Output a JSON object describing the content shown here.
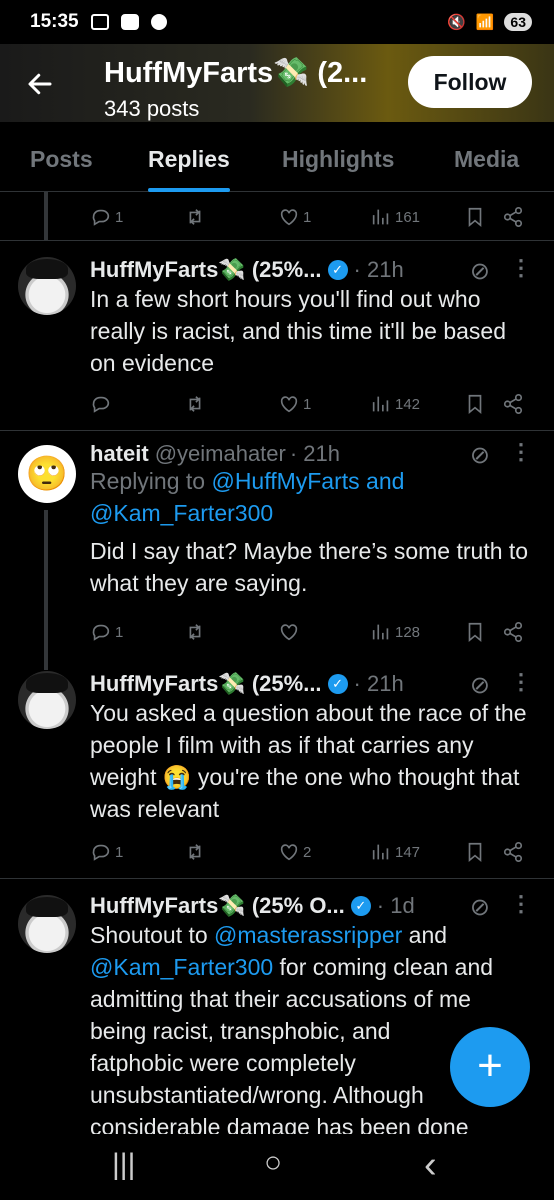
{
  "status_bar": {
    "time": "15:35",
    "battery": "63"
  },
  "header": {
    "title": "HuffMyFarts💸 (2...",
    "posts_count": "343 posts",
    "follow_label": "Follow"
  },
  "tabs": [
    {
      "label": "Posts",
      "active": false
    },
    {
      "label": "Replies",
      "active": true
    },
    {
      "label": "Highlights",
      "active": false
    },
    {
      "label": "Media",
      "active": false
    }
  ],
  "top_actions": {
    "replies": "1",
    "reposts": "",
    "likes": "1",
    "views": "161"
  },
  "tweets": [
    {
      "name": "HuffMyFarts💸 (25%...",
      "handle": "",
      "time": "· 21h",
      "verified": true,
      "reply_to_prefix": "",
      "body": "In a few short hours you'll find out who really is racist, and this time it'll be based on evidence",
      "stats": {
        "replies": "",
        "reposts": "",
        "likes": "1",
        "views": "142"
      }
    },
    {
      "name": "hateit",
      "handle": "@yeimahater",
      "time": "· 21h",
      "verified": false,
      "reply_to_prefix": "Replying to",
      "reply_to_1": "@HuffMyFarts and",
      "reply_to_2": "@Kam_Farter300",
      "body": "Did I say that? Maybe there’s some truth to what they are saying.",
      "stats": {
        "replies": "1",
        "reposts": "",
        "likes": "",
        "views": "128"
      }
    },
    {
      "name": "HuffMyFarts💸 (25%...",
      "handle": "",
      "time": "· 21h",
      "verified": true,
      "body": "You asked a question about the race of the people I film with as if that carries any weight 😭 you're the one who thought that was relevant",
      "stats": {
        "replies": "1",
        "reposts": "",
        "likes": "2",
        "views": "147"
      }
    },
    {
      "name": "HuffMyFarts💸 (25% O...",
      "handle": "",
      "time": "· 1d",
      "verified": true,
      "body_lines": [
        "Shoutout to @masterassripper and",
        "@Kam_Farter300 for coming clean and",
        "admitting that their accusations of me",
        "being racist, transphobic, and",
        "fatphobic were completely",
        "unsubstantiated/wrong. Although",
        "considerable damage has been done"
      ]
    }
  ],
  "fab_label": "+",
  "nav": {
    "recents": "|||",
    "home": "○",
    "back": "‹"
  }
}
